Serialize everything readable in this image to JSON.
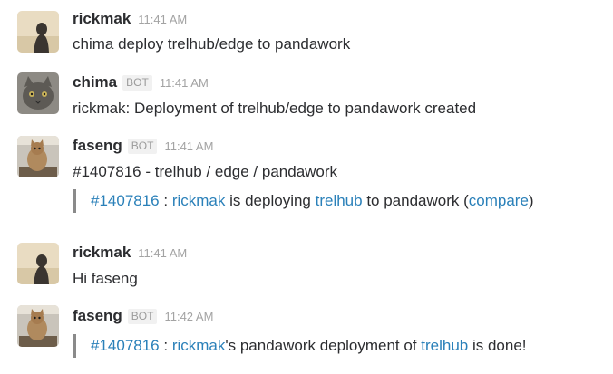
{
  "messages": [
    {
      "author": "rickmak",
      "time": "11:41 AM",
      "avatar": "avatar-rickmak",
      "text": "chima deploy trelhub/edge to pandawork"
    },
    {
      "author": "chima",
      "bot": "BOT",
      "time": "11:41 AM",
      "avatar": "avatar-chima-cat",
      "text": "rickmak: Deployment of trelhub/edge to pandawork created"
    },
    {
      "author": "faseng",
      "bot": "BOT",
      "time": "11:41 AM",
      "avatar": "avatar-faseng-cat",
      "text": "#1407816 - trelhub / edge / pandawork",
      "attachment": {
        "deploy_id": "#1407816",
        "sep1": " : ",
        "user": "rickmak",
        "mid1": " is deploying ",
        "repo": "trelhub",
        "mid2": " to pandawork (",
        "compare": "compare",
        "end": ")"
      }
    },
    {
      "author": "rickmak",
      "time": "11:41 AM",
      "avatar": "avatar-rickmak",
      "text": "Hi faseng"
    },
    {
      "author": "faseng",
      "bot": "BOT",
      "time": "11:42 AM",
      "avatar": "avatar-faseng-cat",
      "attachment": {
        "deploy_id": "#1407816",
        "sep1": " : ",
        "user": "rickmak",
        "mid1": "'s pandawork deployment of ",
        "repo": "trelhub",
        "end": " is done!"
      }
    }
  ],
  "colors": {
    "link": "#2a80b9",
    "text": "#2c2d30",
    "muted": "#a3a3a3",
    "attachment_bar": "#8a8a8a"
  }
}
